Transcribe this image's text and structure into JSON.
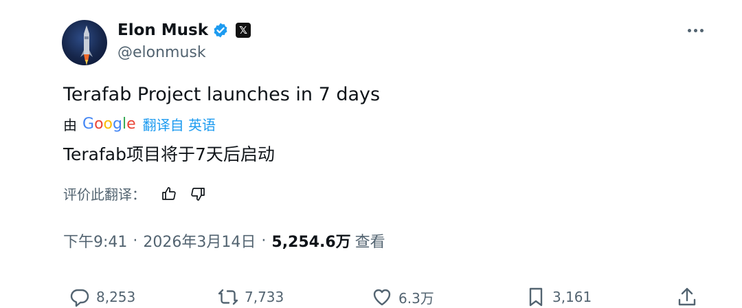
{
  "author": {
    "name": "Elon Musk",
    "handle": "@elonmusk",
    "badge_x": "𝕏"
  },
  "tweet": {
    "text": "Terafab Project launches in 7 days",
    "translated_by": "由",
    "translated_by_brand": "Google",
    "translated_from": "翻译自 英语",
    "translation": "Terafab项目将于7天后启动",
    "rate_translation_label": "评价此翻译："
  },
  "meta": {
    "time": "下午9:41",
    "date": "2026年3月14日",
    "views": "5,254.6万",
    "views_label": "查看"
  },
  "actions": {
    "reply_count": "8,253",
    "retweet_count": "7,733",
    "like_count": "6.3万",
    "bookmark_count": "3,161"
  },
  "colors": {
    "accent": "#1d9bf0",
    "secondary_text": "#536471",
    "text": "#0f1419"
  }
}
